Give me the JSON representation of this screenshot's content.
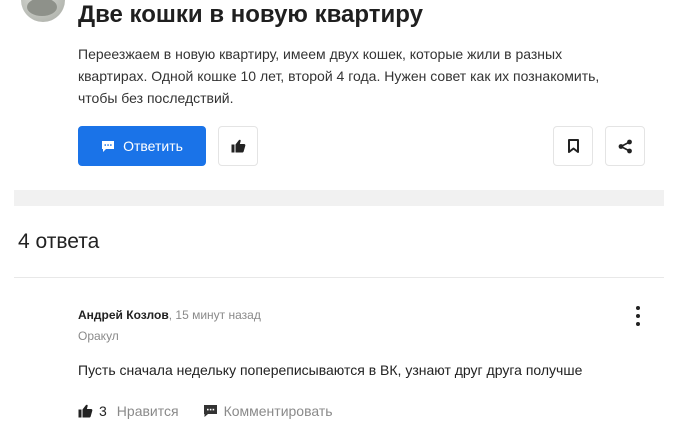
{
  "question": {
    "title": "Две кошки в новую квартиру",
    "body_lines": [
      "Переезжаем в новую квартиру, имеем двух кошек, которые жили в разных",
      "квартирах. Одной кошке 10 лет, второй 4 года. Нужен совет как их познакомить,",
      "чтобы без последствий."
    ]
  },
  "actions": {
    "reply_label": "Ответить"
  },
  "answers": {
    "count_label": "4 ответа"
  },
  "answer": {
    "author": "Андрей Козлов",
    "time": "15 минут назад",
    "role": "Оракул",
    "text": "Пусть сначала недельку попереписываются в ВК, узнают друг друга получше",
    "likes": "3",
    "like_label": "Нравится",
    "comment_label": "Комментировать"
  },
  "colors": {
    "accent": "#1a73e8",
    "muted": "#8a8a8a"
  },
  "icons": [
    "thumbs-up-icon",
    "bookmark-icon",
    "share-icon",
    "comment-icon",
    "more-vertical-icon"
  ]
}
